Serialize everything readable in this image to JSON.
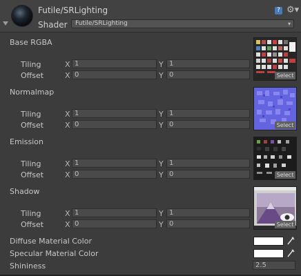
{
  "header": {
    "title": "Futile/SRLighting",
    "shader_label": "Shader",
    "shader_value": "Futile/SRLighting",
    "help_glyph": "?",
    "gear_glyph": "⚙▾"
  },
  "properties": [
    {
      "name": "Base RGBA",
      "tiling_label": "Tiling",
      "offset_label": "Offset",
      "tiling_x": "1",
      "tiling_y": "1",
      "offset_x": "0",
      "offset_y": "0",
      "select": "Select"
    },
    {
      "name": "Normalmap",
      "tiling_label": "Tiling",
      "offset_label": "Offset",
      "tiling_x": "1",
      "tiling_y": "1",
      "offset_x": "0",
      "offset_y": "0",
      "select": "Select"
    },
    {
      "name": "Emission",
      "tiling_label": "Tiling",
      "offset_label": "Offset",
      "tiling_x": "1",
      "tiling_y": "1",
      "offset_x": "0",
      "offset_y": "0",
      "select": "Select"
    },
    {
      "name": "Shadow",
      "tiling_label": "Tiling",
      "offset_label": "Offset",
      "tiling_x": "1",
      "tiling_y": "1",
      "offset_x": "0",
      "offset_y": "0",
      "select": "Select"
    }
  ],
  "axis": {
    "x": "X",
    "y": "Y"
  },
  "colors": {
    "diffuse_label": "Diffuse Material Color",
    "diffuse_value": "#ffffff",
    "specular_label": "Specular Material Color",
    "specular_value": "#ffffff",
    "dropper_glyph": "⁄"
  },
  "shininess": {
    "label": "Shininess",
    "value": "2.5"
  }
}
